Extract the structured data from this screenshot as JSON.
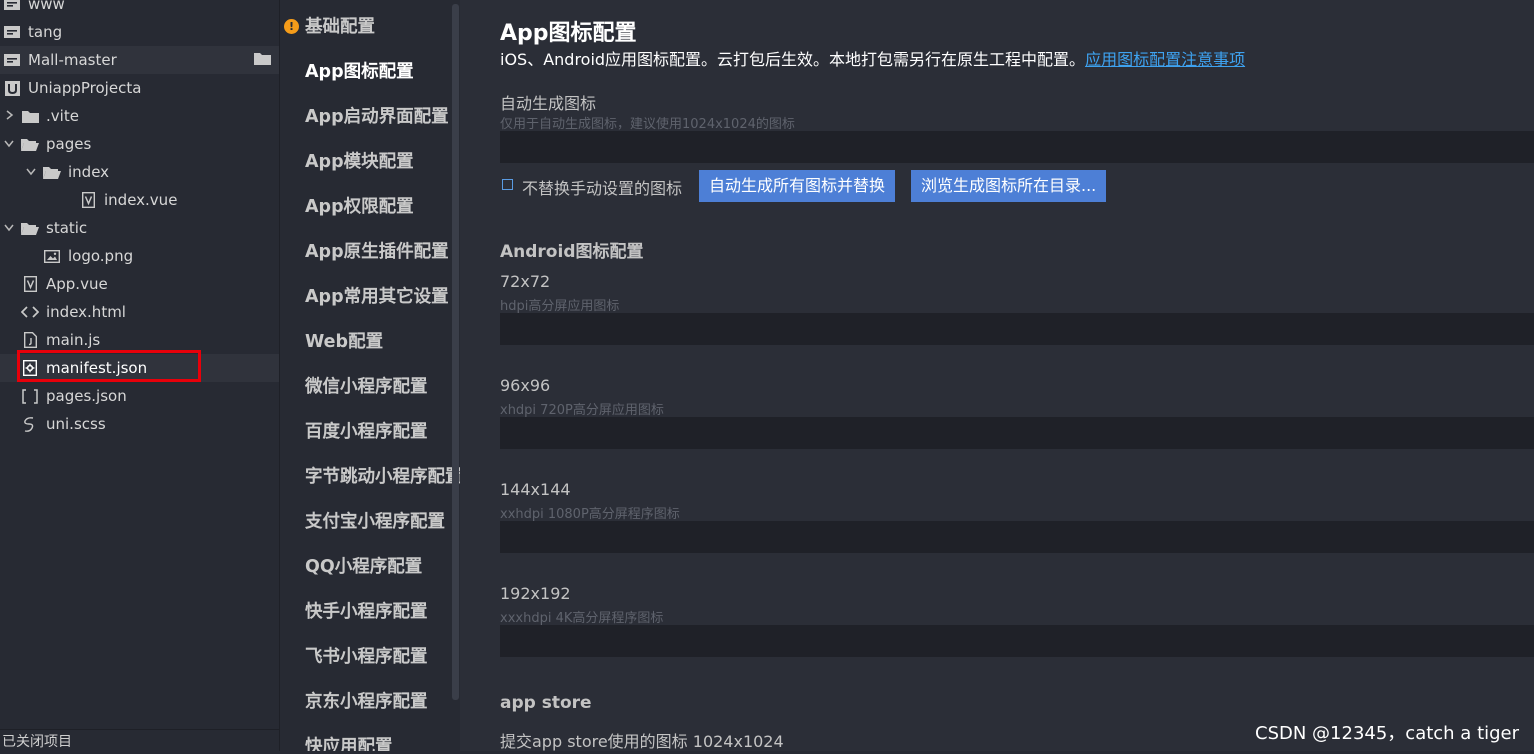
{
  "tree": {
    "items": [
      {
        "label": "www",
        "icon": "project-icon",
        "indent": 0,
        "chevron": ""
      },
      {
        "label": "tang",
        "icon": "project-icon",
        "indent": 0,
        "chevron": ""
      },
      {
        "label": "Mall-master",
        "icon": "project-icon",
        "indent": 0,
        "chevron": ""
      },
      {
        "label": "UniappProjecta",
        "icon": "uni-project-icon",
        "indent": 0,
        "chevron": ""
      },
      {
        "label": ".vite",
        "icon": "folder-icon",
        "indent": 1,
        "chevron": "right"
      },
      {
        "label": "pages",
        "icon": "folder-open-icon",
        "indent": 1,
        "chevron": "down"
      },
      {
        "label": "index",
        "icon": "folder-open-icon",
        "indent": 2,
        "chevron": "down"
      },
      {
        "label": "index.vue",
        "icon": "vue-file-icon",
        "indent": 3,
        "chevron": ""
      },
      {
        "label": "static",
        "icon": "folder-open-icon",
        "indent": 1,
        "chevron": "down"
      },
      {
        "label": "logo.png",
        "icon": "image-file-icon",
        "indent": 2,
        "chevron": ""
      },
      {
        "label": "App.vue",
        "icon": "vue-file-icon",
        "indent": 1,
        "chevron": ""
      },
      {
        "label": "index.html",
        "icon": "html-file-icon",
        "indent": 1,
        "chevron": ""
      },
      {
        "label": "main.js",
        "icon": "js-file-icon",
        "indent": 1,
        "chevron": ""
      },
      {
        "label": "manifest.json",
        "icon": "settings-file-icon",
        "indent": 1,
        "chevron": ""
      },
      {
        "label": "pages.json",
        "icon": "json-file-icon",
        "indent": 1,
        "chevron": ""
      },
      {
        "label": "uni.scss",
        "icon": "scss-file-icon",
        "indent": 1,
        "chevron": ""
      }
    ],
    "selected": "manifest.json",
    "footer": "已关闭项目"
  },
  "nav": {
    "items": [
      {
        "label": "基础配置",
        "warning": true
      },
      {
        "label": "App图标配置",
        "active": true
      },
      {
        "label": "App启动界面配置"
      },
      {
        "label": "App模块配置"
      },
      {
        "label": "App权限配置"
      },
      {
        "label": "App原生插件配置"
      },
      {
        "label": "App常用其它设置"
      },
      {
        "label": "Web配置"
      },
      {
        "label": "微信小程序配置"
      },
      {
        "label": "百度小程序配置"
      },
      {
        "label": "字节跳动小程序配置"
      },
      {
        "label": "支付宝小程序配置"
      },
      {
        "label": "QQ小程序配置"
      },
      {
        "label": "快手小程序配置"
      },
      {
        "label": "飞书小程序配置"
      },
      {
        "label": "京东小程序配置"
      },
      {
        "label": "快应用配置"
      }
    ]
  },
  "content": {
    "title": "App图标配置",
    "desc": "iOS、Android应用图标配置。云打包后生效。本地打包需另行在原生工程中配置。",
    "desc_link": "应用图标配置注意事项",
    "auto_label": "自动生成图标",
    "auto_sub": "仅用于自动生成图标，建议使用1024x1024的图标",
    "auto_value": "",
    "checkbox_label": "不替换手动设置的图标",
    "btn_generate": "自动生成所有图标并替换",
    "btn_browse": "浏览生成图标所在目录...",
    "android_section": "Android图标配置",
    "android_fields": [
      {
        "label": "72x72",
        "sub": "hdpi高分屏应用图标",
        "value": ""
      },
      {
        "label": "96x96",
        "sub": "xhdpi 720P高分屏应用图标",
        "value": ""
      },
      {
        "label": "144x144",
        "sub": "xxhdpi 1080P高分屏程序图标",
        "value": ""
      },
      {
        "label": "192x192",
        "sub": "xxxhdpi 4K高分屏程序图标",
        "value": ""
      }
    ],
    "appstore_section": "app store",
    "appstore_label": "提交app store使用的图标 1024x1024",
    "watermark": "CSDN @12345，catch a tiger"
  },
  "colors": {
    "accent": "#4d7fd6",
    "link": "#3ea2f0",
    "selection_box": "#e8000a",
    "warning": "#f59c1a"
  }
}
